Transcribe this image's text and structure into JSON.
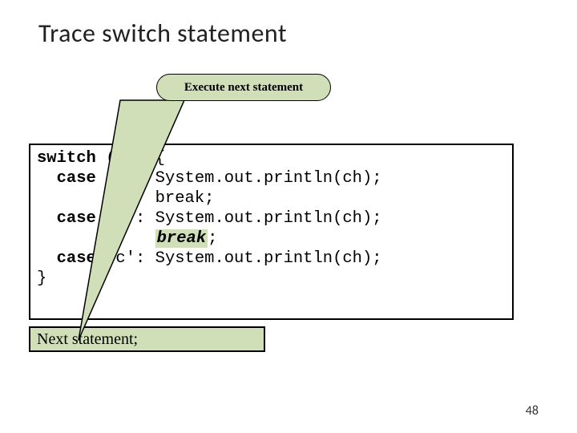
{
  "slide": {
    "title": "Trace switch statement",
    "callout": "Execute next statement",
    "code": {
      "l1a": "switch",
      "l1b": " (ch) {",
      "l2a": "  ",
      "l2b": "case",
      "l2c": " 'a': System.out.println(ch);",
      "l3": "            break;",
      "l4a": "  ",
      "l4b": "case",
      "l4c": " 'b': System.out.println(ch);",
      "l5a": "            ",
      "l5b": "break",
      "l5c": ";",
      "l6a": "  ",
      "l6b": "case",
      "l6c": " 'c': System.out.println(ch);",
      "l7": "}"
    },
    "nextStatement": "Next statement;",
    "pageNumber": "48"
  }
}
